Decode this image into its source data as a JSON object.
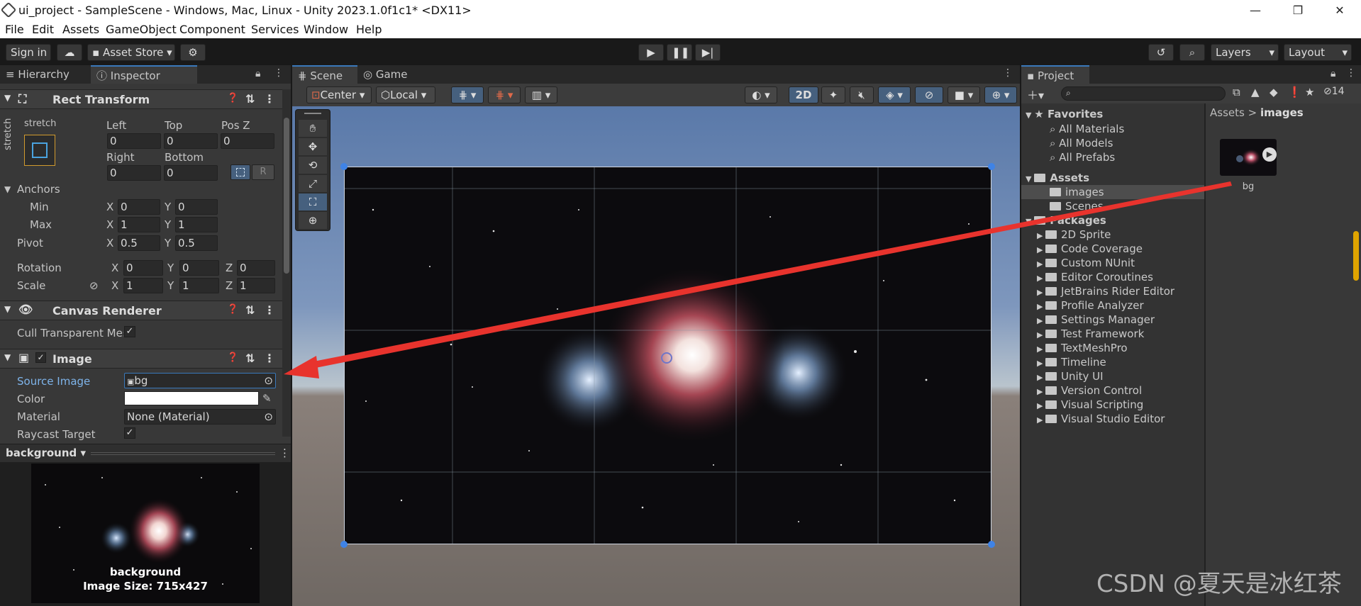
{
  "window": {
    "title": "ui_project - SampleScene - Windows, Mac, Linux - Unity 2023.1.0f1c1* <DX11>",
    "minimize": "—",
    "maximize": "❐",
    "close": "✕"
  },
  "menu": [
    "File",
    "Edit",
    "Assets",
    "GameObject",
    "Component",
    "Services",
    "Window",
    "Help"
  ],
  "toolbar": {
    "sign_in": "Sign in",
    "asset_store": "Asset Store",
    "layers": "Layers",
    "layout": "Layout"
  },
  "left_tabs": {
    "hierarchy": "Hierarchy",
    "inspector": "Inspector"
  },
  "rect_transform": {
    "title": "Rect Transform",
    "stretch_top": "stretch",
    "stretch_side": "stretch",
    "left_label": "Left",
    "top_label": "Top",
    "posz_label": "Pos Z",
    "left": "0",
    "top": "0",
    "posz": "0",
    "right_label": "Right",
    "bottom_label": "Bottom",
    "right": "0",
    "bottom": "0",
    "r_button": "R",
    "anchors_label": "Anchors",
    "min_label": "Min",
    "max_label": "Max",
    "min_x": "0",
    "min_y": "0",
    "max_x": "1",
    "max_y": "1",
    "pivot_label": "Pivot",
    "pivot_x": "0.5",
    "pivot_y": "0.5",
    "rotation_label": "Rotation",
    "rot_x": "0",
    "rot_y": "0",
    "rot_z": "0",
    "scale_label": "Scale",
    "scale_x": "1",
    "scale_y": "1",
    "scale_z": "1"
  },
  "canvas_renderer": {
    "title": "Canvas Renderer",
    "cull_label": "Cull Transparent Mes"
  },
  "image": {
    "title": "Image",
    "source_label": "Source Image",
    "source_value": "bg",
    "color_label": "Color",
    "material_label": "Material",
    "material_value": "None (Material)",
    "raycast_label": "Raycast Target"
  },
  "preview": {
    "dropdown": "background",
    "caption": "background",
    "size": "Image Size: 715x427"
  },
  "scene_tabs": {
    "scene": "Scene",
    "game": "Game"
  },
  "scene_toolbar": {
    "center": "Center",
    "local": "Local",
    "mode_2d": "2D"
  },
  "project": {
    "tab": "Project",
    "breadcrumb_root": "Assets",
    "breadcrumb_current": "images",
    "asset_name": "bg",
    "hidden_count": "14",
    "favorites_label": "Favorites",
    "favorites": [
      "All Materials",
      "All Models",
      "All Prefabs"
    ],
    "assets_label": "Assets",
    "assets": [
      "images",
      "Scenes"
    ],
    "packages_label": "Packages",
    "packages": [
      "2D Sprite",
      "Code Coverage",
      "Custom NUnit",
      "Editor Coroutines",
      "JetBrains Rider Editor",
      "Profile Analyzer",
      "Settings Manager",
      "Test Framework",
      "TextMeshPro",
      "Timeline",
      "Unity UI",
      "Version Control",
      "Visual Scripting",
      "Visual Studio Editor"
    ]
  },
  "watermark": "CSDN @夏天是冰红茶",
  "colors": {
    "accent": "#3a79bb",
    "arrow": "#e8332d",
    "panel": "#383838",
    "sky": "#5f7fb0"
  }
}
